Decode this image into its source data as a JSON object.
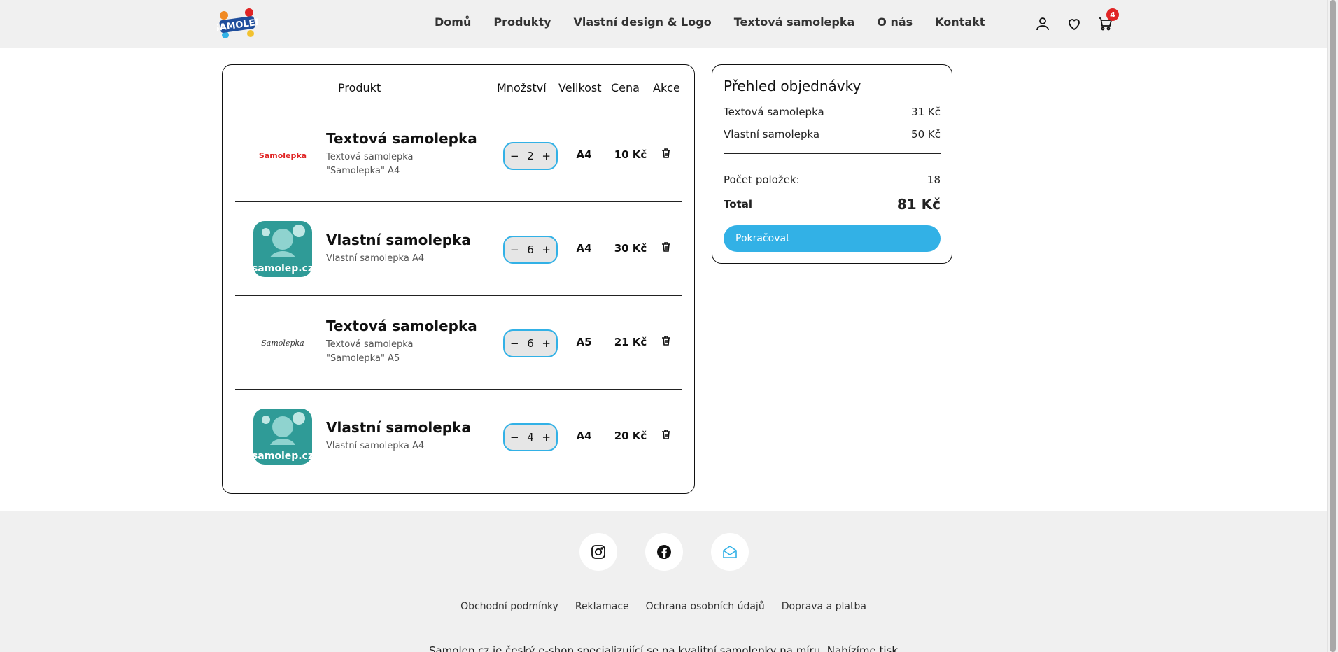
{
  "header": {
    "logo_text": "SAMOLEP",
    "nav": [
      "Domů",
      "Produkty",
      "Vlastní design & Logo",
      "Textová samolepka",
      "O nás",
      "Kontakt"
    ],
    "icons": [
      "user-icon",
      "heart-icon",
      "cart-icon"
    ],
    "cart_count": "4"
  },
  "cart": {
    "headers": {
      "product": "Produkt",
      "quantity": "Množství",
      "size": "Velikost",
      "price": "Cena",
      "action": "Akce"
    },
    "items": [
      {
        "name": "Textová samolepka",
        "desc": "Textová samolepka \"Samolepka\" A4",
        "thumb_text": "Samolepka",
        "qty": "2",
        "size": "A4",
        "price": "10 Kč"
      },
      {
        "name": "Vlastní samolepka",
        "desc": "Vlastní samolepka A4",
        "thumb_text": "samolep.cz",
        "qty": "6",
        "size": "A4",
        "price": "30 Kč"
      },
      {
        "name": "Textová samolepka",
        "desc": "Textová samolepka \"Samolepka\" A5",
        "thumb_text": "Samolepka",
        "qty": "6",
        "size": "A5",
        "price": "21 Kč"
      },
      {
        "name": "Vlastní samolepka",
        "desc": "Vlastní samolepka A4",
        "thumb_text": "samolep.cz",
        "qty": "4",
        "size": "A4",
        "price": "20 Kč"
      }
    ],
    "controls": {
      "minus": "−",
      "plus": "+"
    }
  },
  "summary": {
    "title": "Přehled objednávky",
    "lines": [
      {
        "label": "Textová samolepka",
        "value": "31 Kč"
      },
      {
        "label": "Vlastní samolepka",
        "value": "50 Kč"
      }
    ],
    "count_label": "Počet položek:",
    "count_value": "18",
    "total_label": "Total",
    "total_value": "81 Kč",
    "cta": "Pokračovat"
  },
  "footer": {
    "social": [
      "instagram-icon",
      "facebook-icon",
      "email-icon"
    ],
    "links": [
      "Obchodní podmínky",
      "Reklamace",
      "Ochrana osobních údajů",
      "Doprava a platba"
    ],
    "text": "Samolep.cz je český e-shop specializující se na kvalitní samolepky na míru. Nabízíme tisk"
  },
  "colors": {
    "accent": "#32b1e6",
    "badge": "#e02424",
    "header_bg": "#f0f0f0",
    "teal": "#2f9b97"
  }
}
